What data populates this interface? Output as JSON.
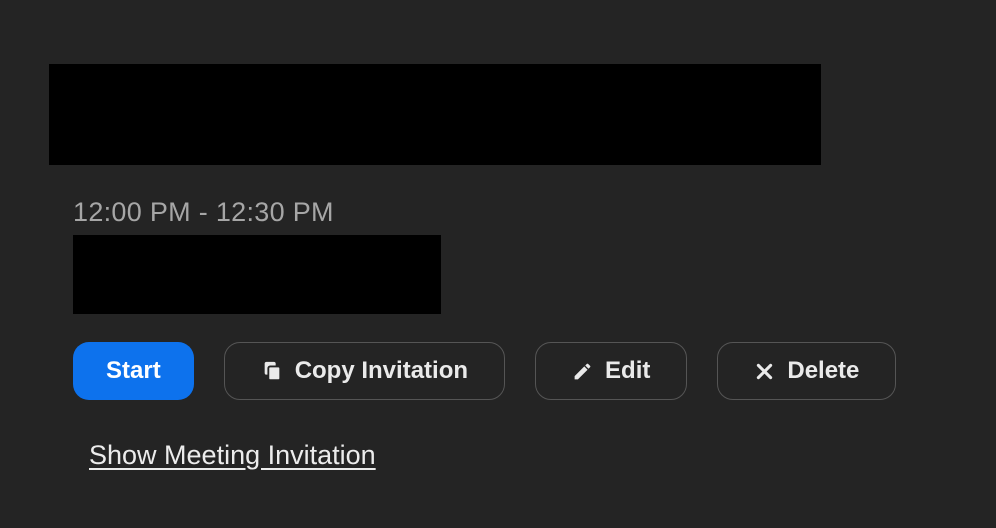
{
  "meeting": {
    "time_range": "12:00 PM - 12:30 PM"
  },
  "actions": {
    "start_label": "Start",
    "copy_label": "Copy Invitation",
    "edit_label": "Edit",
    "delete_label": "Delete"
  },
  "links": {
    "show_invitation_label": "Show Meeting Invitation"
  },
  "icons": {
    "copy": "copy-icon",
    "edit": "pencil-icon",
    "delete": "x-icon"
  }
}
